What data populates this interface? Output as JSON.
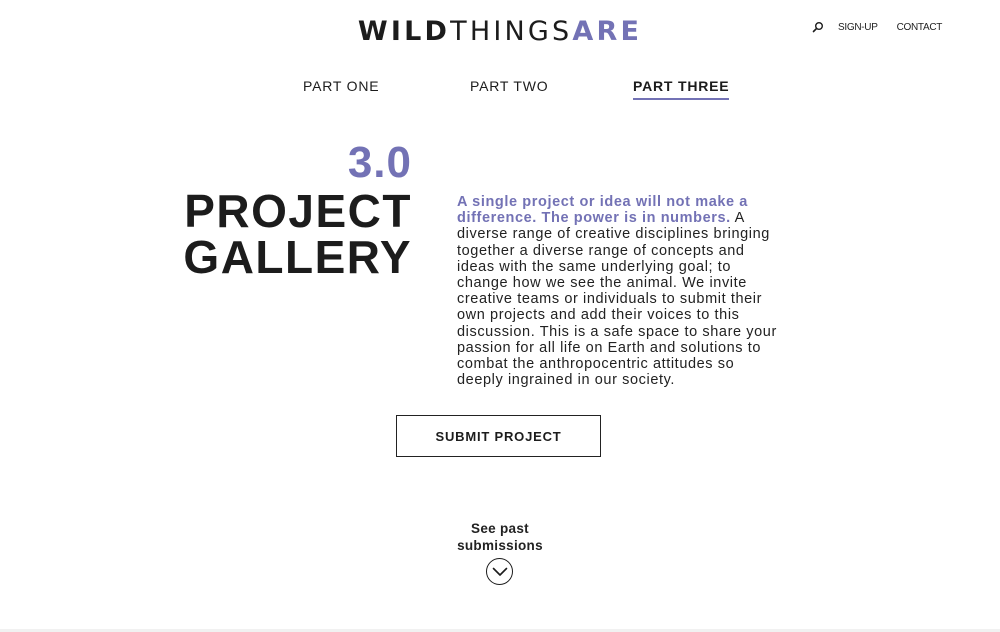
{
  "brand": {
    "logo_part1": "WILD",
    "logo_part2": "THINGS",
    "logo_part3": "ARE",
    "accent_color": "#7372b5"
  },
  "top_nav": {
    "search_icon": "search-icon",
    "sign_up": "SIGN-UP",
    "contact": "CONTACT"
  },
  "tabs": [
    {
      "label": "PART ONE",
      "active": false
    },
    {
      "label": "PART TWO",
      "active": false
    },
    {
      "label": "PART THREE",
      "active": true
    }
  ],
  "hero": {
    "number": "3.0",
    "title_line1": "PROJECT",
    "title_line2": "GALLERY"
  },
  "intro": {
    "lead": "A single project or idea will not make a difference. The power is in numbers.",
    "body": " A diverse range of creative disciplines bringing together a diverse range of concepts and ideas with the same underlying goal; to change how we see the animal. We invite creative teams or individuals to submit their own projects and add their voices to this discussion. This is a safe space to share your passion for all life on Earth and solutions to combat the anthropocentric attitudes so deeply ingrained in our society."
  },
  "cta": {
    "submit_label": "SUBMIT PROJECT"
  },
  "past": {
    "line1": "See past",
    "line2": "submissions",
    "icon": "chevron-down-icon"
  }
}
